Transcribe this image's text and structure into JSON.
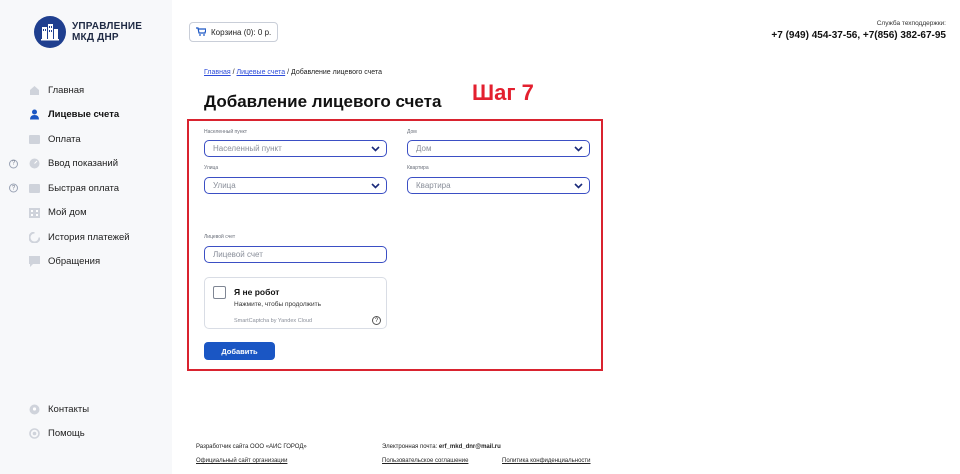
{
  "brand": {
    "line1": "УПРАВЛЕНИЕ",
    "line2": "МКД ДНР",
    "color": "#1f3f8f"
  },
  "sidebar": {
    "items": [
      {
        "label": "Главная",
        "icon": "home-icon",
        "active": false,
        "help": false
      },
      {
        "label": "Лицевые счета",
        "icon": "user-icon",
        "active": true,
        "help": false
      },
      {
        "label": "Оплата",
        "icon": "card-icon",
        "active": false,
        "help": false
      },
      {
        "label": "Ввод показаний",
        "icon": "meter-icon",
        "active": false,
        "help": true
      },
      {
        "label": "Быстрая оплата",
        "icon": "fast-pay-icon",
        "active": false,
        "help": true
      },
      {
        "label": "Мой дом",
        "icon": "building-icon",
        "active": false,
        "help": false
      },
      {
        "label": "История платежей",
        "icon": "history-icon",
        "active": false,
        "help": false
      },
      {
        "label": "Обращения",
        "icon": "message-icon",
        "active": false,
        "help": false
      }
    ],
    "bottom_items": [
      {
        "label": "Контакты",
        "icon": "location-icon"
      },
      {
        "label": "Помощь",
        "icon": "help-icon"
      }
    ],
    "help_badge": "?"
  },
  "header": {
    "cart_label": "Корзина (0): 0 р.",
    "support_label": "Служба техподдержки:",
    "support_phones": "+7 (949) 454-37-56, +7(856) 382-67-95"
  },
  "breadcrumb": {
    "home": "Главная",
    "accounts": "Лицевые счета",
    "current": "Добавление лицевого счета",
    "separator": " / "
  },
  "page_title": "Добавление лицевого счета",
  "step_label": "Шаг 7",
  "form": {
    "locality": {
      "label": "Населенный пункт",
      "placeholder": "Населенный пункт"
    },
    "house": {
      "label": "Дом",
      "placeholder": "Дом"
    },
    "street": {
      "label": "Улица",
      "placeholder": "Улица"
    },
    "apartment": {
      "label": "Квартира",
      "placeholder": "Квартира"
    },
    "account": {
      "label": "Лицевой счет",
      "placeholder": "Лицевой счет"
    },
    "submit_label": "Добавить"
  },
  "captcha": {
    "title": "Я не робот",
    "subtitle": "Нажмите, чтобы продолжить",
    "brand": "SmartCaptcha by Yandex Cloud",
    "help": "?"
  },
  "footer": {
    "developer": "Разработчик сайта ООО «АИС ГОРОД»",
    "official_site": "Официальный сайт организации",
    "email_label": "Электронная почта: ",
    "email": "erf_mkd_dnr@mail.ru",
    "user_agreement": "Пользовательское соглашение",
    "privacy_policy": "Политика конфиденциальности"
  },
  "colors": {
    "accent": "#1a56c4",
    "highlight": "#d9232f",
    "field_border": "#3b4fc4"
  }
}
